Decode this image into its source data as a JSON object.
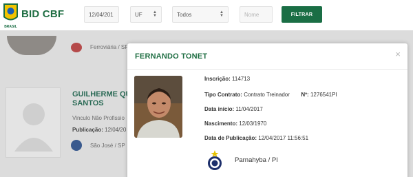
{
  "header": {
    "brand": "BID CBF",
    "logo_text": "BRASIL",
    "date_value": "12/04/201",
    "uf_value": "UF",
    "todos_value": "Todos",
    "nome_placeholder": "Nome",
    "filter_label": "FILTRAR",
    "accent_color": "#1a6e45"
  },
  "background_list": {
    "row1_club": "Ferroviária / SP",
    "row2_name": "GUILHERME QU... SANTOS",
    "row2_name_line1": "GUILHERME QU",
    "row2_name_line2": "SANTOS",
    "row2_contract": "Vinculo Não Profissio",
    "row2_pub_label": "Publicação:",
    "row2_pub_value": "12/04/20",
    "row2_club": "São José / SP"
  },
  "modal": {
    "title": "FERNANDO TONET",
    "close_icon": "×",
    "inscricao_label": "Inscrição:",
    "inscricao_value": "114713",
    "tipo_label": "Tipo Contrato:",
    "tipo_value": "Contrato Treinador",
    "n_label": "Nº:",
    "n_value": "1276541PI",
    "inicio_label": "Data início:",
    "inicio_value": "11/04/2017",
    "nasc_label": "Nascimento:",
    "nasc_value": "12/03/1970",
    "pub_label": "Data de Publicação:",
    "pub_value": "12/04/2017 11:56:51",
    "club": "Parnahyba / PI"
  }
}
